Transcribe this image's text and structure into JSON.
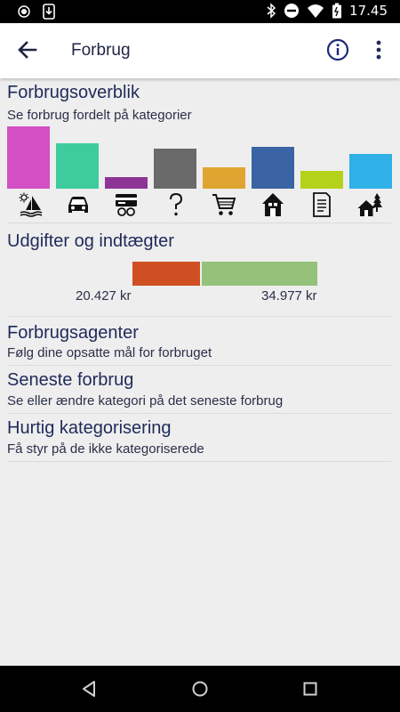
{
  "status_bar": {
    "time": "17.45",
    "left_icons": [
      "circle-icon",
      "download-icon"
    ],
    "right_icons": [
      "bluetooth-icon",
      "do-not-disturb-icon",
      "wifi-icon",
      "battery-icon"
    ]
  },
  "app_bar": {
    "title": "Forbrug",
    "back_icon": "arrow-left-icon",
    "info_icon": "info-icon",
    "more_icon": "more-vertical-icon"
  },
  "overview": {
    "title": "Forbrugsoverblik",
    "subtitle": "Se forbrug fordelt på kategorier",
    "categories": [
      {
        "icon": "leisure-sailboat-icon",
        "color": "#d44fc4",
        "value": 1.0
      },
      {
        "icon": "car-icon",
        "color": "#3ecc9c",
        "value": 0.73
      },
      {
        "icon": "card-coins-icon",
        "color": "#8d3596",
        "value": 0.19
      },
      {
        "icon": "question-icon",
        "color": "#6a6a6a",
        "value": 0.64
      },
      {
        "icon": "shopping-cart-icon",
        "color": "#e0a530",
        "value": 0.34
      },
      {
        "icon": "house-icon",
        "color": "#3a64a4",
        "value": 0.67
      },
      {
        "icon": "document-icon",
        "color": "#b5d21a",
        "value": 0.29
      },
      {
        "icon": "house-trees-icon",
        "color": "#2fb0e6",
        "value": 0.56
      }
    ]
  },
  "income_expenses": {
    "title": "Udgifter og indtægter",
    "expenses": {
      "label": "20.427 kr",
      "value": 20427,
      "color": "#cf4f22"
    },
    "income": {
      "label": "34.977 kr",
      "value": 34977,
      "color": "#94c27a"
    }
  },
  "menu": [
    {
      "title": "Forbrugsagenter",
      "subtitle": "Følg dine opsatte mål for forbruget"
    },
    {
      "title": "Seneste forbrug",
      "subtitle": "Se eller ændre kategori på det seneste forbrug"
    },
    {
      "title": "Hurtig kategorisering",
      "subtitle": "Få styr på de ikke kategoriserede"
    }
  ],
  "nav_bar": {
    "icons": [
      "back-triangle-icon",
      "home-circle-icon",
      "recents-square-icon"
    ]
  }
}
